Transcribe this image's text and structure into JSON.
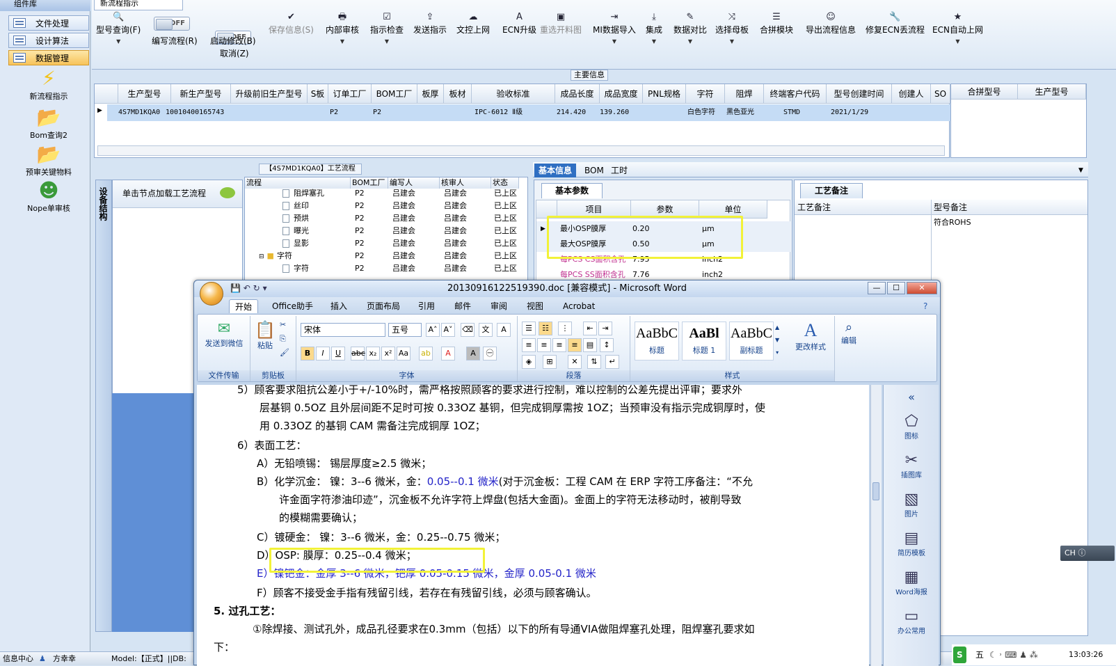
{
  "left_panel": {
    "title": "组件库",
    "buttons": [
      {
        "label": "文件处理"
      },
      {
        "label": "设计算法"
      },
      {
        "label": "数据管理"
      }
    ],
    "items": [
      {
        "label": "新流程指示",
        "icon": "lightning-icon"
      },
      {
        "label": "Bom查询2",
        "icon": "folder-icon"
      },
      {
        "label": "预审关键物料",
        "icon": "folder-icon"
      },
      {
        "label": "Nope单审核",
        "icon": "user-icon"
      }
    ]
  },
  "tab_title": "新流程指示",
  "toolbar": {
    "model_query": "型号查询(F)",
    "edit_flow_toggle": "OFF",
    "edit_flow": "编写流程(R)",
    "start_modify_toggle": "OFF",
    "start_modify": "启动修改(B)",
    "cancel": "取消(Z)",
    "save_info": "保存信息(S)",
    "internal_review": "内部审核",
    "indicator_check": "指示检查",
    "send_indicator": "发送指示",
    "upload_internet": "文控上网",
    "ecn_upgrade": "ECN升级",
    "reselect_cut": "重选开料图",
    "mi_import": "MI数据导入",
    "collect": "集成",
    "data_compare": "数据对比",
    "select_mother": "选择母板",
    "merge_module": "合拼模块",
    "export_flow": "导出流程信息",
    "repair_ecn": "修复ECN丢流程",
    "ecn_auto": "ECN自动上网"
  },
  "main_info": {
    "header": "主要信息",
    "columns": [
      "生产型号",
      "新生产型号",
      "升级前旧生产型号",
      "S板",
      "订单工厂",
      "BOM工厂",
      "板厚",
      "板材",
      "验收标准",
      "成品长度",
      "成品宽度",
      "PNL规格",
      "字符",
      "阻焊",
      "终端客户代码",
      "型号创建时间",
      "创建人",
      "SO"
    ],
    "row": {
      "prod_model": "4S7MD1KQA0",
      "new_model": "10010400165743",
      "order_factory": "P2",
      "bom_factory": "P2",
      "standard": "IPC-6012 Ⅱ级",
      "length": "214.420",
      "width": "139.260",
      "char": "白色字符",
      "solder": "黑色亚光",
      "customer": "STMD",
      "created": "2021/1/29"
    },
    "side_columns": [
      "合拼型号",
      "生产型号"
    ]
  },
  "sidebar_vertical": "设备结构",
  "node_panel_label": "单击节点加载工艺流程",
  "flow": {
    "title": "【4S7MD1KQA0】工艺流程",
    "columns": [
      "流程",
      "BOM工厂",
      "编写人",
      "核审人",
      "状态"
    ],
    "rows": [
      {
        "name": "阻焊塞孔",
        "bom": "P2",
        "writer": "吕建会",
        "reviewer": "吕建会",
        "status": "已上区"
      },
      {
        "name": "丝印",
        "bom": "P2",
        "writer": "吕建会",
        "reviewer": "吕建会",
        "status": "已上区"
      },
      {
        "name": "预烘",
        "bom": "P2",
        "writer": "吕建会",
        "reviewer": "吕建会",
        "status": "已上区"
      },
      {
        "name": "曝光",
        "bom": "P2",
        "writer": "吕建会",
        "reviewer": "吕建会",
        "status": "已上区"
      },
      {
        "name": "显影",
        "bom": "P2",
        "writer": "吕建会",
        "reviewer": "吕建会",
        "status": "已上区"
      },
      {
        "name": "字符",
        "bom": "P2",
        "writer": "吕建会",
        "reviewer": "吕建会",
        "status": "已上区"
      },
      {
        "name": "字符",
        "bom": "P2",
        "writer": "吕建会",
        "reviewer": "吕建会",
        "status": "已上区"
      }
    ]
  },
  "right_tabs": [
    "基本信息",
    "BOM",
    "工时"
  ],
  "basic": {
    "tab": "基本参数",
    "columns": [
      "项目",
      "参数",
      "单位"
    ],
    "rows": [
      {
        "item": "最小OSP膜厚",
        "value": "0.20",
        "unit": "μm"
      },
      {
        "item": "最大OSP膜厚",
        "value": "0.50",
        "unit": "μm"
      },
      {
        "item": "每PCS CS面积含孔",
        "value": "7.95",
        "unit": "inch2"
      },
      {
        "item": "每PCS SS面积含孔",
        "value": "7.76",
        "unit": "inch2"
      }
    ]
  },
  "remark": {
    "tab": "工艺备注",
    "col1": "工艺备注",
    "col2": "型号备注",
    "value": "符合ROHS"
  },
  "statusbar": {
    "info": "信息中心",
    "user": "方幸幸",
    "model": "Model:【正式】||DB:"
  },
  "word": {
    "title": "20130916122519390.doc [兼容模式] - Microsoft Word",
    "menus": [
      "开始",
      "Office助手",
      "插入",
      "页面布局",
      "引用",
      "邮件",
      "审阅",
      "视图",
      "Acrobat"
    ],
    "groups": {
      "wechat": "发送到微信",
      "wechat_group": "文件传输",
      "paste": "粘贴",
      "clipboard": "剪贴板",
      "font_name": "宋体",
      "font_size": "五号",
      "font_group": "字体",
      "para_group": "段落",
      "styles": [
        {
          "sample": "AaBbC",
          "name": "标题"
        },
        {
          "sample": "AaBl",
          "name": "标题 1"
        },
        {
          "sample": "AaBbC",
          "name": "副标题"
        }
      ],
      "change_style": "更改样式",
      "style_group": "样式",
      "edit": "编辑"
    },
    "doc_lines": [
      "5）顾客要求阻抗公差小于+/-10%时，需严格按照顾客的要求进行控制，难以控制的公差先提出评审；要求外",
      "层基铜 0.5OZ 且外层间距不足时可按 0.33OZ 基铜，但完成铜厚需按 1OZ；当预审没有指示完成铜厚时，使",
      "用 0.33OZ 的基铜 CAM 需备注完成铜厚 1OZ；",
      "6）表面工艺：",
      "A）无铅喷锡：  锡层厚度≥2.5 微米；",
      "B）化学沉金：  镍：3--6 微米，金：",
      "0.05--0.1 微米",
      "(对于沉金板：工程 CAM 在 ERP 字符工序备注：“不允",
      "许金面字符渗油印迹”，沉金板不允许字符上焊盘(包括大金面)。金面上的字符无法移动时，被削导致",
      "的模糊需要确认；",
      "C）镀硬金：   镍：3--6 微米，金：0.25--0.75 微米；",
      "D）OSP:         膜厚：0.25--0.4 微米；",
      "E）镍钯金：金厚 3--6 微米，钯厚 0.05-0.15 微米，金厚 0.05-0.1 微米",
      "F）顾客不接受金手指有残留引线，若存在有残留引线，必须与顾客确认。",
      "5.   过孔工艺：",
      "①除焊接、测试孔外，成品孔径要求在0.3mm（包括）以下的所有导通VIA做阻焊塞孔处理，阻焊塞孔要求如",
      "下："
    ],
    "side_items": [
      "图标",
      "插图库",
      "图片",
      "简历模板",
      "Word海报",
      "办公常用"
    ]
  },
  "ime": "CH",
  "tray_time": "13:03:26",
  "tray_ime": "五"
}
